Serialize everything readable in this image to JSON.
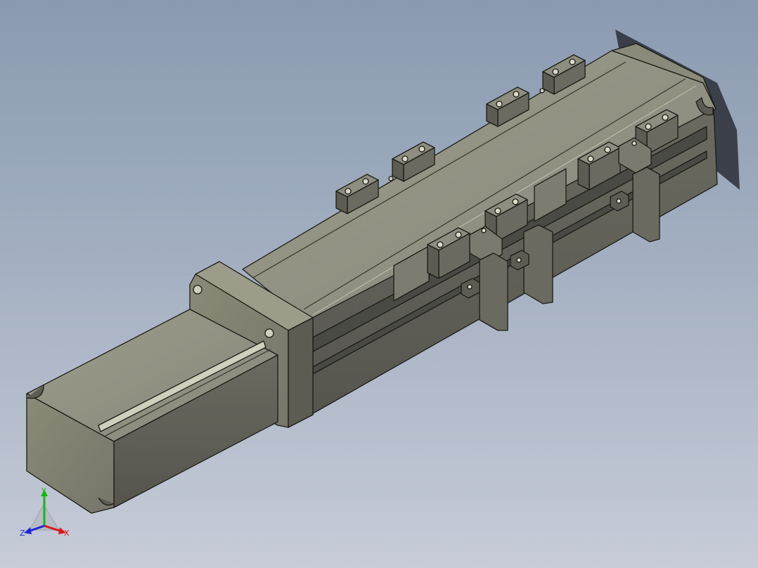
{
  "viewport": {
    "background_top": "#8a9ab1",
    "background_bottom": "#c7ccd8"
  },
  "model": {
    "part": "linear-actuator-assembly",
    "body_color": "#6f6f62",
    "highlight_color": "#9a9a88",
    "edge_color": "#1b1b16"
  },
  "triad": {
    "x_label": "X",
    "y_label": "Y",
    "z_label": "Z",
    "x_color": "#d81818",
    "y_color": "#18b418",
    "z_color": "#1e28d2"
  }
}
